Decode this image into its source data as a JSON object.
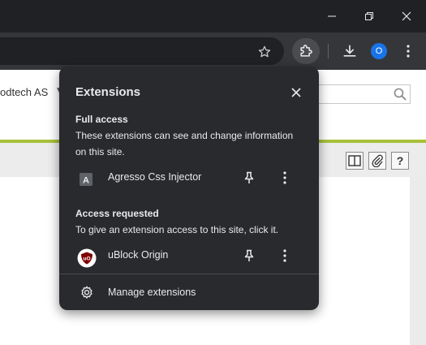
{
  "window": {
    "minimize_icon": "minimize-icon",
    "maximize_icon": "restore-icon",
    "close_icon": "close-icon"
  },
  "toolbar": {
    "bookmark_icon": "star-icon",
    "extensions_icon": "puzzle-icon",
    "download_icon": "download-icon",
    "profile_badge": "O",
    "menu_icon": "more-vertical-icon"
  },
  "page": {
    "company_text": "odtech AS",
    "search_icon": "search-icon",
    "buttons": [
      "split-view-icon",
      "paperclip-icon",
      "?"
    ],
    "accent_color": "#a7c23a"
  },
  "extensions_popup": {
    "title": "Extensions",
    "full_access": {
      "heading": "Full access",
      "description": "These extensions can see and change information on this site.",
      "items": [
        {
          "name": "Agresso Css Injector",
          "icon_letter": "A"
        }
      ]
    },
    "access_requested": {
      "heading": "Access requested",
      "description": "To give an extension access to this site, click it.",
      "items": [
        {
          "name": "uBlock Origin",
          "icon_letter": "uO"
        }
      ]
    },
    "manage_label": "Manage extensions",
    "colors": {
      "background": "#292a2d",
      "text": "#e8eaed",
      "ublock_red": "#800000"
    }
  }
}
